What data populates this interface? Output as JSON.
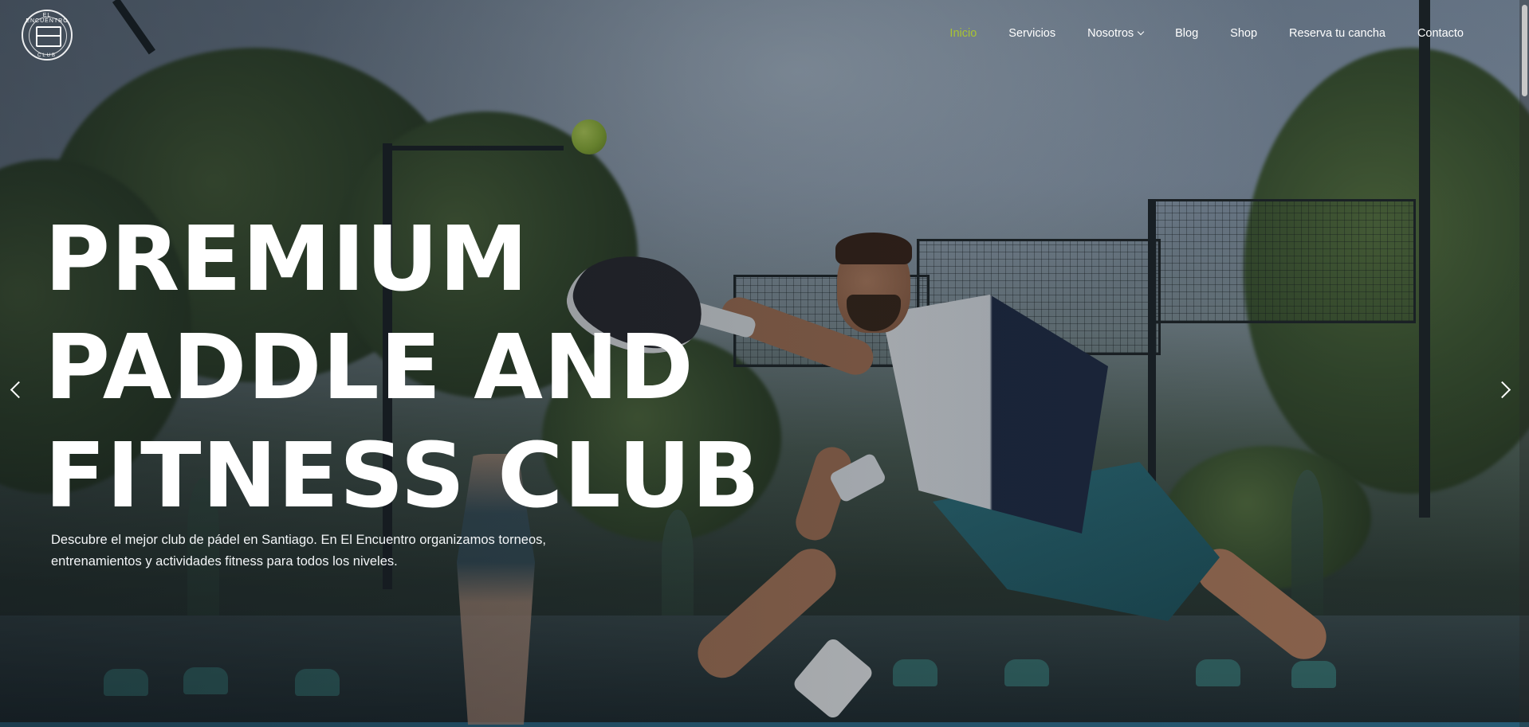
{
  "logo": {
    "top_text": "EL ENCUENTRO",
    "bottom_text": "CLUB"
  },
  "nav": {
    "items": [
      {
        "label": "Inicio",
        "active": true
      },
      {
        "label": "Servicios",
        "active": false
      },
      {
        "label": "Nosotros",
        "active": false,
        "has_dropdown": true
      },
      {
        "label": "Blog",
        "active": false
      },
      {
        "label": "Shop",
        "active": false
      },
      {
        "label": "Reserva tu cancha",
        "active": false
      },
      {
        "label": "Contacto",
        "active": false
      }
    ]
  },
  "hero": {
    "title_lines": [
      "PREMIUM",
      "PADDLE AND",
      "FITNESS CLUB"
    ],
    "description": "Descubre el mejor club de pádel en Santiago. En El Encuentro organizamos torneos, entrenamientos y actividades fitness para todos los niveles."
  },
  "slider": {
    "prev_icon": "chevron-left-icon",
    "next_icon": "chevron-right-icon"
  },
  "colors": {
    "accent": "#a9c431",
    "text": "#ffffff"
  }
}
